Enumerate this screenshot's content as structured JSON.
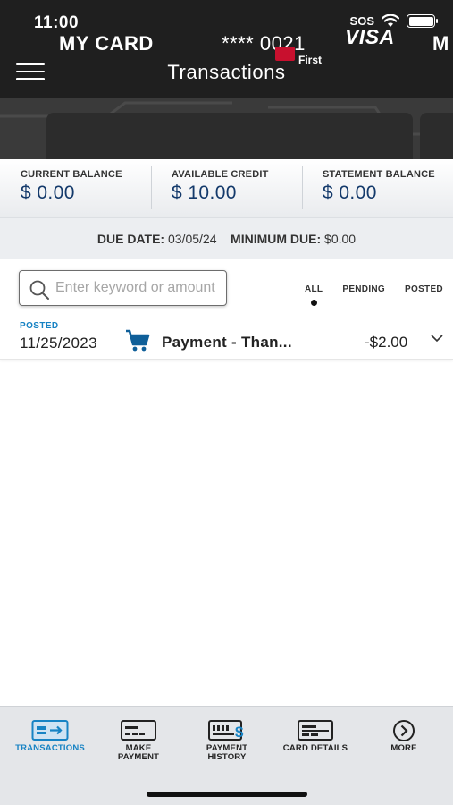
{
  "status_bar": {
    "time": "11:00",
    "carrier": "SOS"
  },
  "header": {
    "title": "Transactions"
  },
  "card": {
    "name": "MY CARD",
    "number": "**** 0021",
    "network": "VISA",
    "issuer_text": "First",
    "next_card_name": "M"
  },
  "balances": [
    {
      "label": "CURRENT BALANCE",
      "value": "$ 0.00"
    },
    {
      "label": "AVAILABLE CREDIT",
      "value": "$ 10.00"
    },
    {
      "label": "STATEMENT BALANCE",
      "value": "$ 0.00"
    }
  ],
  "due": {
    "due_label": "DUE DATE:",
    "due_value": "03/05/24",
    "min_label": "MINIMUM DUE:",
    "min_value": "$0.00"
  },
  "search": {
    "placeholder": "Enter keyword or amount",
    "value": ""
  },
  "filters": {
    "tabs": [
      {
        "label": "ALL",
        "active": true
      },
      {
        "label": "PENDING",
        "active": false
      },
      {
        "label": "POSTED",
        "active": false
      }
    ]
  },
  "transactions": [
    {
      "status": "POSTED",
      "date": "11/25/2023",
      "icon": "shopping-cart-icon",
      "description": "Payment - Than...",
      "amount": "-$2.00"
    }
  ],
  "bottom_nav": {
    "items": [
      {
        "label": "TRANSACTIONS",
        "icon": "transactions-icon",
        "active": true
      },
      {
        "label": "MAKE PAYMENT",
        "icon": "make-payment-icon",
        "active": false
      },
      {
        "label": "PAYMENT HISTORY",
        "icon": "payment-history-icon",
        "active": false
      },
      {
        "label": "CARD DETAILS",
        "icon": "card-details-icon",
        "active": false
      },
      {
        "label": "MORE",
        "icon": "more-icon",
        "active": false
      }
    ]
  },
  "colors": {
    "header_bg": "#1f1f1f",
    "accent": "#1783c4",
    "balance_value": "#143a6b",
    "cart_icon": "#0f5f99",
    "nav_bg": "#e4e6e9"
  }
}
